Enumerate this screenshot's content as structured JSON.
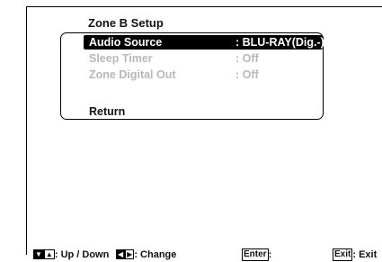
{
  "menu": {
    "title": "Zone B Setup",
    "items": [
      {
        "label": "Audio Source",
        "value": ": BLU-RAY(Dig.-)",
        "state": "selected"
      },
      {
        "label": "Sleep Timer",
        "value": ": Off",
        "state": "disabled"
      },
      {
        "label": "Zone Digital Out",
        "value": ": Off",
        "state": "disabled"
      }
    ],
    "return_label": "Return"
  },
  "footer": {
    "nav_keys": [
      "▼",
      "▲"
    ],
    "nav_text": ": Up / Down",
    "change_keys": [
      "◀",
      "▶"
    ],
    "change_text": ": Change",
    "enter_key": "Enter",
    "enter_text": ":",
    "exit_key": "Exit",
    "exit_text": ": Exit"
  }
}
